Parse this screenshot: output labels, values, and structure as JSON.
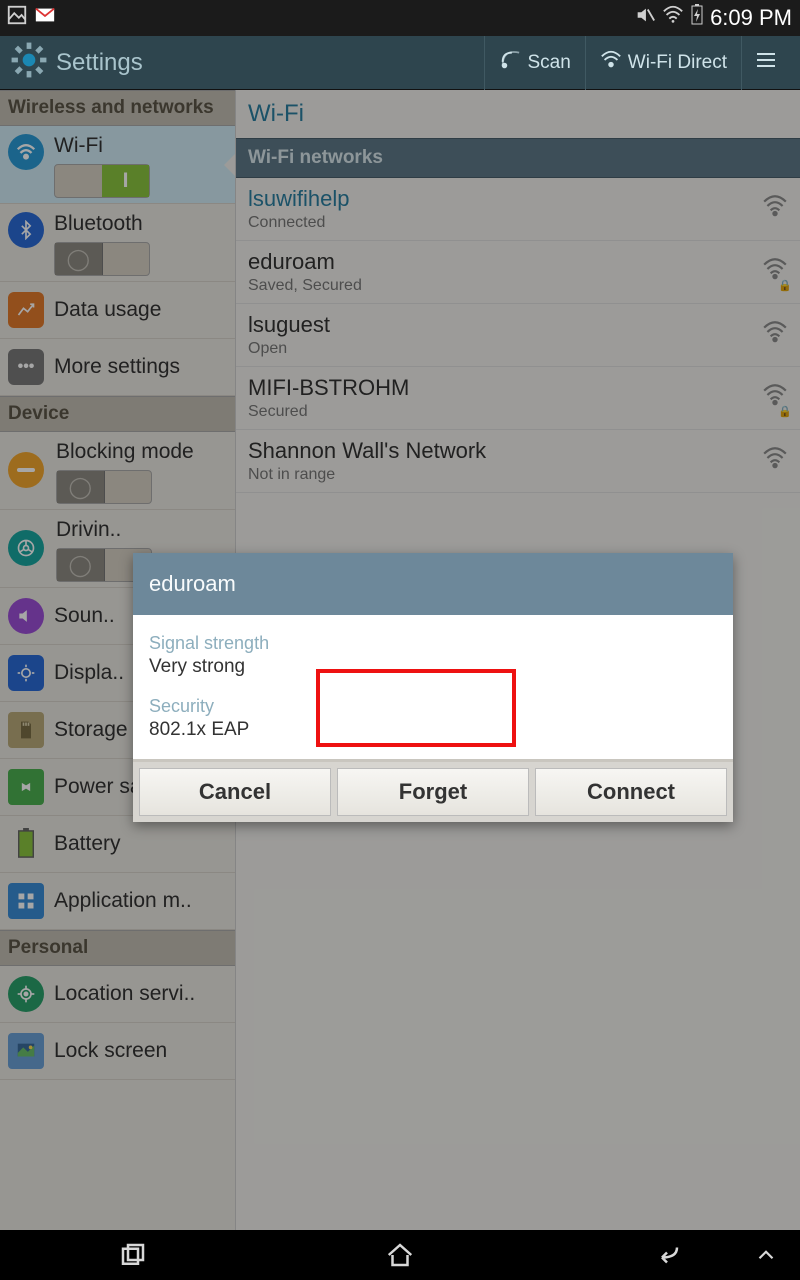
{
  "status": {
    "time": "6:09 PM"
  },
  "actionbar": {
    "title": "Settings",
    "scan": "Scan",
    "wifidirect": "Wi-Fi Direct"
  },
  "sidebar": {
    "sec_wireless": "Wireless and networks",
    "sec_device": "Device",
    "sec_personal": "Personal",
    "wifi": "Wi-Fi",
    "bluetooth": "Bluetooth",
    "datausage": "Data usage",
    "more": "More settings",
    "blocking": "Blocking mode",
    "driving": "Drivin..",
    "sound": "Soun..",
    "display": "Displa..",
    "storage": "Storage",
    "power": "Power saving..",
    "battery": "Battery",
    "appman": "Application m..",
    "location": "Location servi..",
    "lockscreen": "Lock screen"
  },
  "pane": {
    "title": "Wi-Fi",
    "subtitle": "Wi-Fi networks",
    "networks": [
      {
        "name": "lsuwifihelp",
        "status": "Connected",
        "link": true,
        "lock": false
      },
      {
        "name": "eduroam",
        "status": "Saved, Secured",
        "link": false,
        "lock": true
      },
      {
        "name": "lsuguest",
        "status": "Open",
        "link": false,
        "lock": false
      },
      {
        "name": "MIFI-BSTROHM",
        "status": "Secured",
        "link": false,
        "lock": true
      },
      {
        "name": "Shannon Wall's Network",
        "status": "Not in range",
        "link": false,
        "lock": false
      }
    ]
  },
  "dialog": {
    "title": "eduroam",
    "signal_label": "Signal strength",
    "signal_value": "Very strong",
    "security_label": "Security",
    "security_value": "802.1x EAP",
    "cancel": "Cancel",
    "forget": "Forget",
    "connect": "Connect"
  }
}
